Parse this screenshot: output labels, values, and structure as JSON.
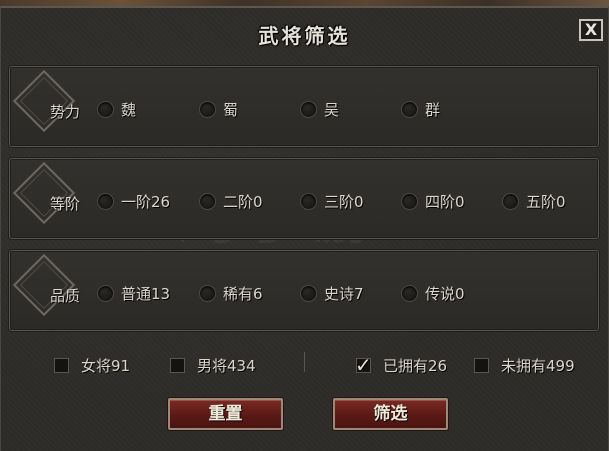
{
  "dialog": {
    "title": "武将筛选",
    "close_label": "X"
  },
  "filters": {
    "faction": {
      "label": "势力",
      "options": [
        {
          "label": "魏"
        },
        {
          "label": "蜀"
        },
        {
          "label": "吴"
        },
        {
          "label": "群"
        }
      ]
    },
    "tier": {
      "label": "等阶",
      "options": [
        {
          "label": "一阶26"
        },
        {
          "label": "二阶0"
        },
        {
          "label": "三阶0"
        },
        {
          "label": "四阶0"
        },
        {
          "label": "五阶0"
        }
      ]
    },
    "quality": {
      "label": "品质",
      "options": [
        {
          "label": "普通13"
        },
        {
          "label": "稀有6"
        },
        {
          "label": "史诗7"
        },
        {
          "label": "传说0"
        }
      ]
    }
  },
  "checkboxes": [
    {
      "label": "女将91",
      "checked": false
    },
    {
      "label": "男将434",
      "checked": false
    },
    {
      "label": "已拥有26",
      "checked": true
    },
    {
      "label": "未拥有499",
      "checked": false
    }
  ],
  "buttons": {
    "reset": "重置",
    "filter": "筛选"
  },
  "watermark": {
    "main": "淘手游",
    "sub": "Taoshouyou.Com"
  }
}
